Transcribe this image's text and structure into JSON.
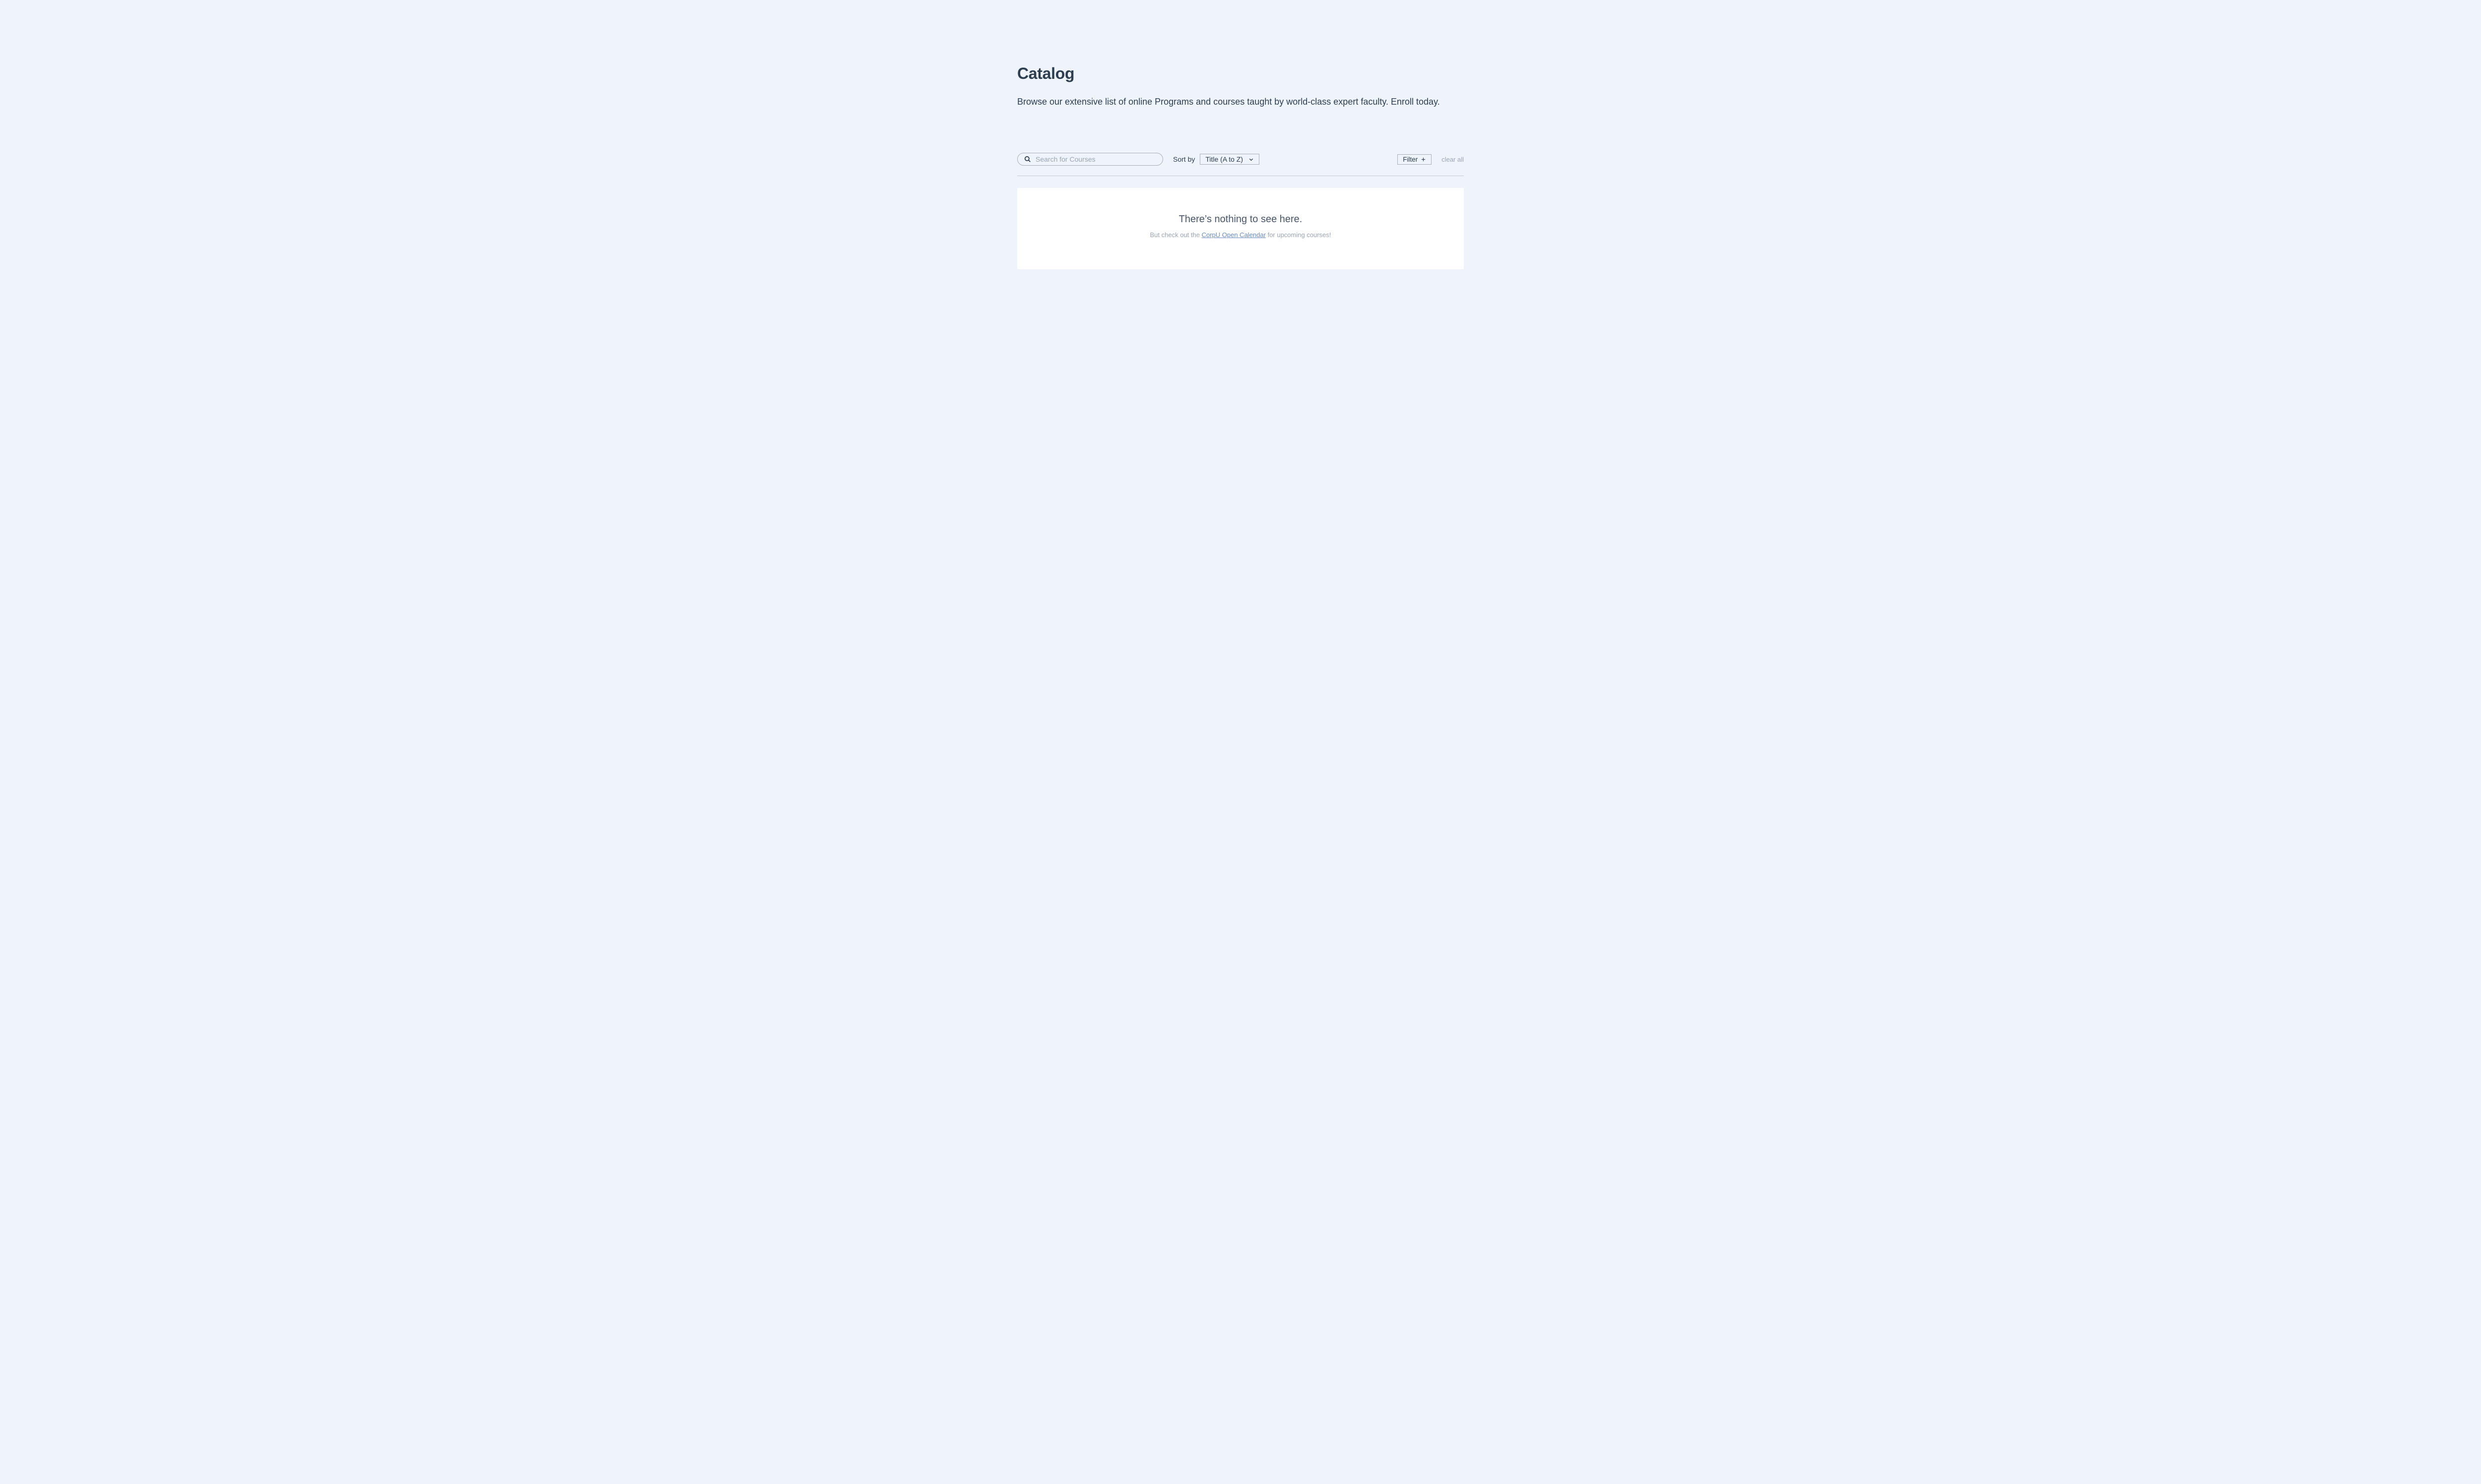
{
  "page": {
    "title": "Catalog",
    "description": "Browse our extensive list of online Programs and courses taught by world-class expert faculty. Enroll today."
  },
  "search": {
    "placeholder": "Search for Courses",
    "value": ""
  },
  "sort": {
    "label": "Sort by",
    "selected": "Title (A to Z)"
  },
  "filter": {
    "button_label": "Filter",
    "clear_all_label": "clear all"
  },
  "empty": {
    "heading": "There’s nothing to see here.",
    "sub_prefix": "But check out the ",
    "link_text": "CorpU Open Calendar",
    "sub_suffix": " for upcoming courses!"
  }
}
